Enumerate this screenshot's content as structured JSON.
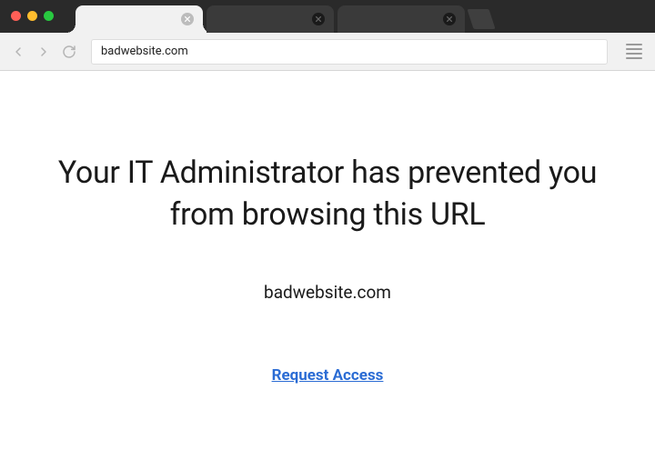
{
  "browser": {
    "url": "badwebsite.com"
  },
  "page": {
    "headline": "Your IT Administrator has prevented you from browsing this URL",
    "blocked_url": "badwebsite.com",
    "request_access_label": "Request Access"
  }
}
